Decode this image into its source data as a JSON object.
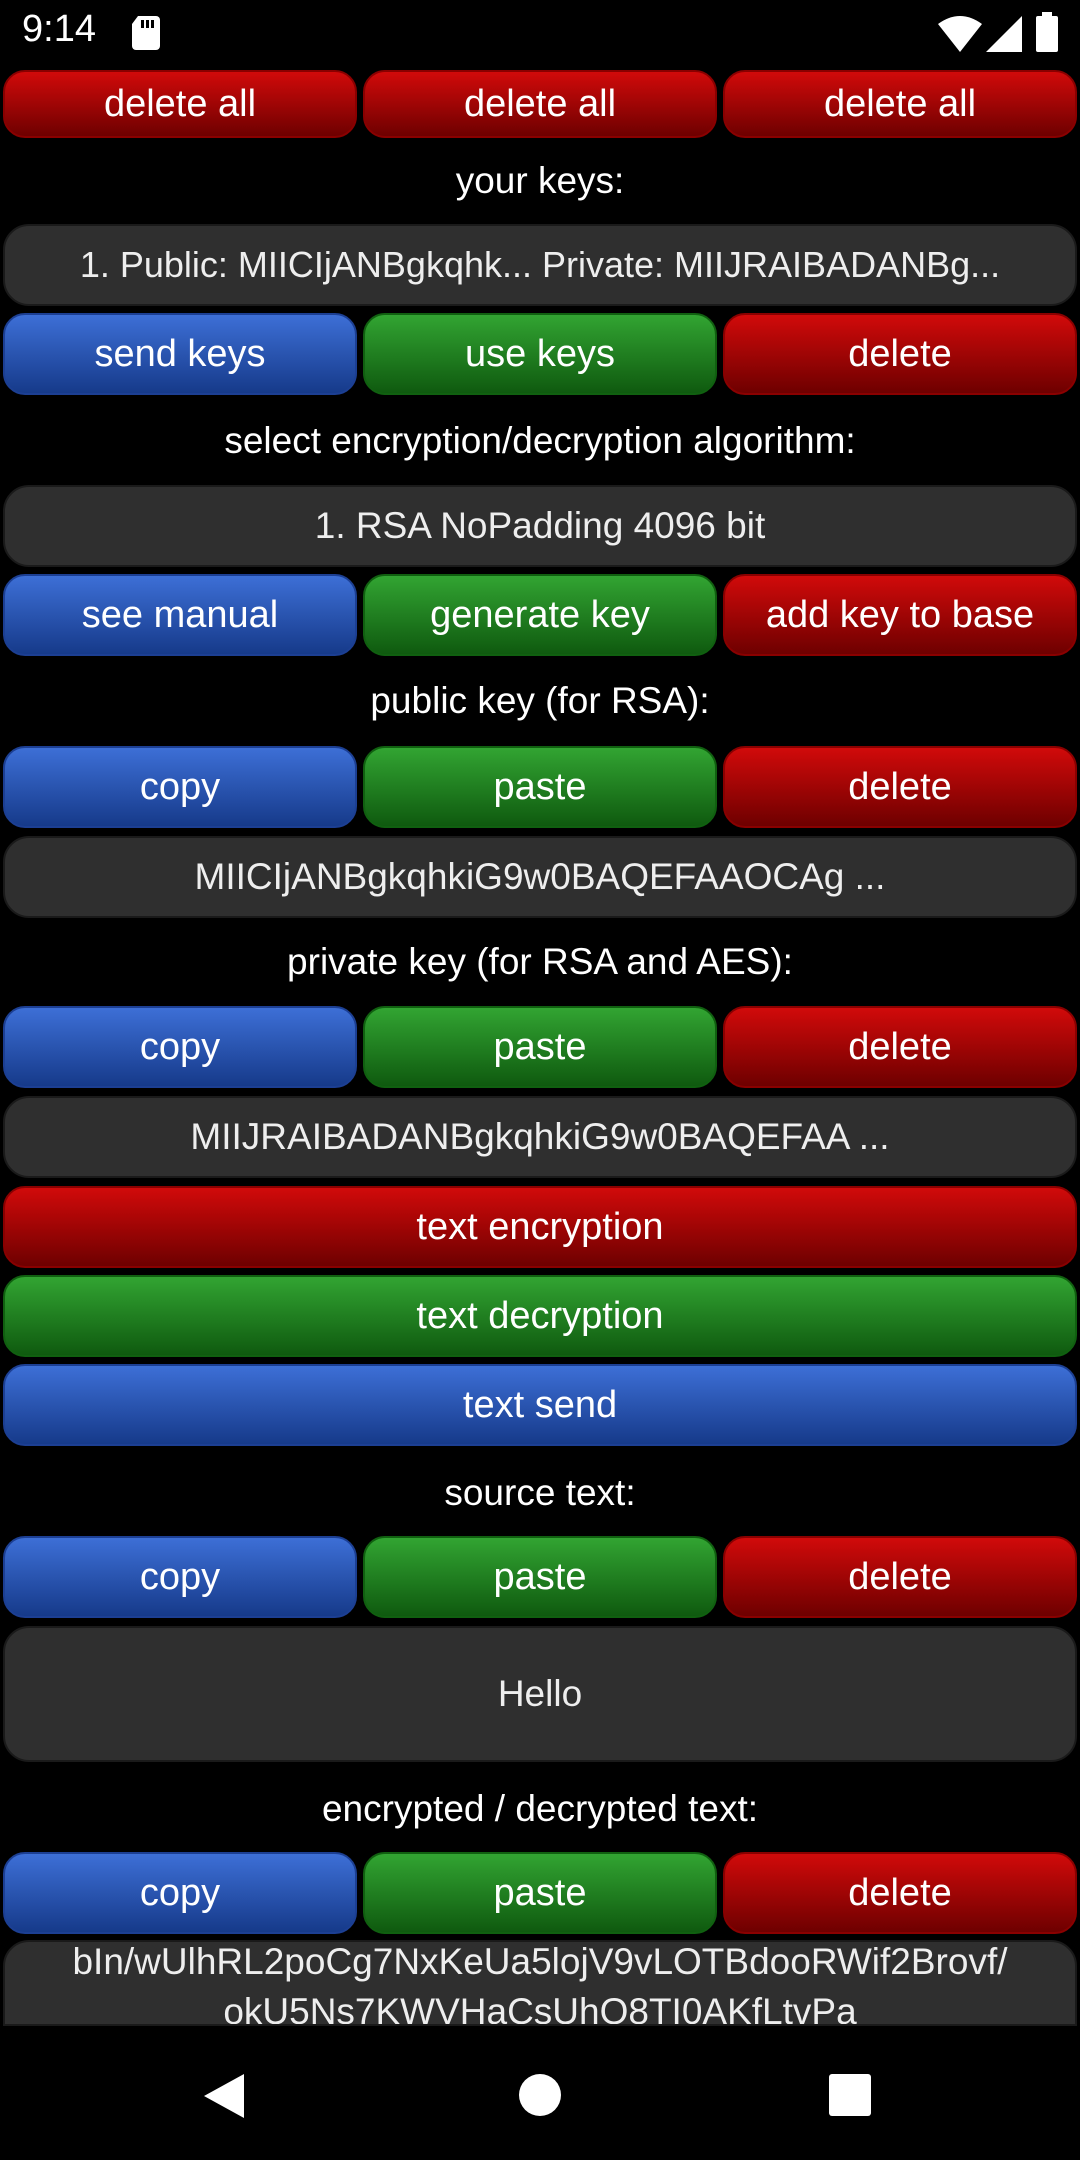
{
  "status_bar": {
    "time": "9:14"
  },
  "top_row": {
    "left": "delete all",
    "middle": "delete all",
    "right": "delete all"
  },
  "keys": {
    "label": "your keys:",
    "selected": "1. Public: MIICIjANBgkqhk... Private: MIIJRAIBADANBg...",
    "send": "send keys",
    "use": "use keys",
    "delete": "delete"
  },
  "algorithm": {
    "label": "select encryption/decryption algorithm:",
    "selected": "1. RSA NoPadding 4096 bit",
    "manual": "see manual",
    "generate": "generate key",
    "add": "add key to base"
  },
  "public_key": {
    "label": "public key (for RSA):",
    "copy": "copy",
    "paste": "paste",
    "delete": "delete",
    "value": "MIICIjANBgkqhkiG9w0BAQEFAAOCAg ..."
  },
  "private_key": {
    "label": "private key (for RSA and AES):",
    "copy": "copy",
    "paste": "paste",
    "delete": "delete",
    "value": "MIIJRAIBADANBgkqhkiG9w0BAQEFAA ..."
  },
  "actions": {
    "encrypt": "text encryption",
    "decrypt": "text decryption",
    "send": "text send"
  },
  "source": {
    "label": "source text:",
    "copy": "copy",
    "paste": "paste",
    "delete": "delete",
    "value": "Hello"
  },
  "output": {
    "label": "encrypted / decrypted text:",
    "copy": "copy",
    "paste": "paste",
    "delete": "delete",
    "line1": "bIn/wUlhRL2poCg7NxKeUa5lojV9vLOTBdooRWif2Brovf/",
    "line2": "okU5Ns7KWVHaCsUhO8TI0AKfLtvPa"
  },
  "colors": {
    "red": "#b00000",
    "green": "#228b22",
    "blue": "#2a55b8",
    "field": "#2f2f2f"
  }
}
